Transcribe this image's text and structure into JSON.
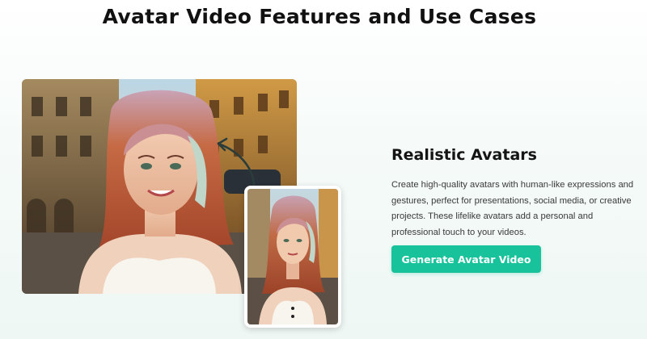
{
  "page": {
    "title": "Avatar Video Features and Use Cases"
  },
  "feature": {
    "title": "Realistic Avatars",
    "description": "Create high-quality avatars with human-like expressions and gestures, perfect for presentations, social media, or creative projects. These lifelike avatars add a personal and professional touch to your videos.",
    "button_label": "Generate Avatar Video"
  },
  "images": {
    "main": "avatar-photo-original",
    "thumb": "avatar-photo-generated",
    "arrow": "curved-arrow-icon"
  },
  "colors": {
    "accent": "#18c29a",
    "title": "#111111",
    "body_text": "#3a3a3a",
    "hair": "#c65a3a"
  }
}
